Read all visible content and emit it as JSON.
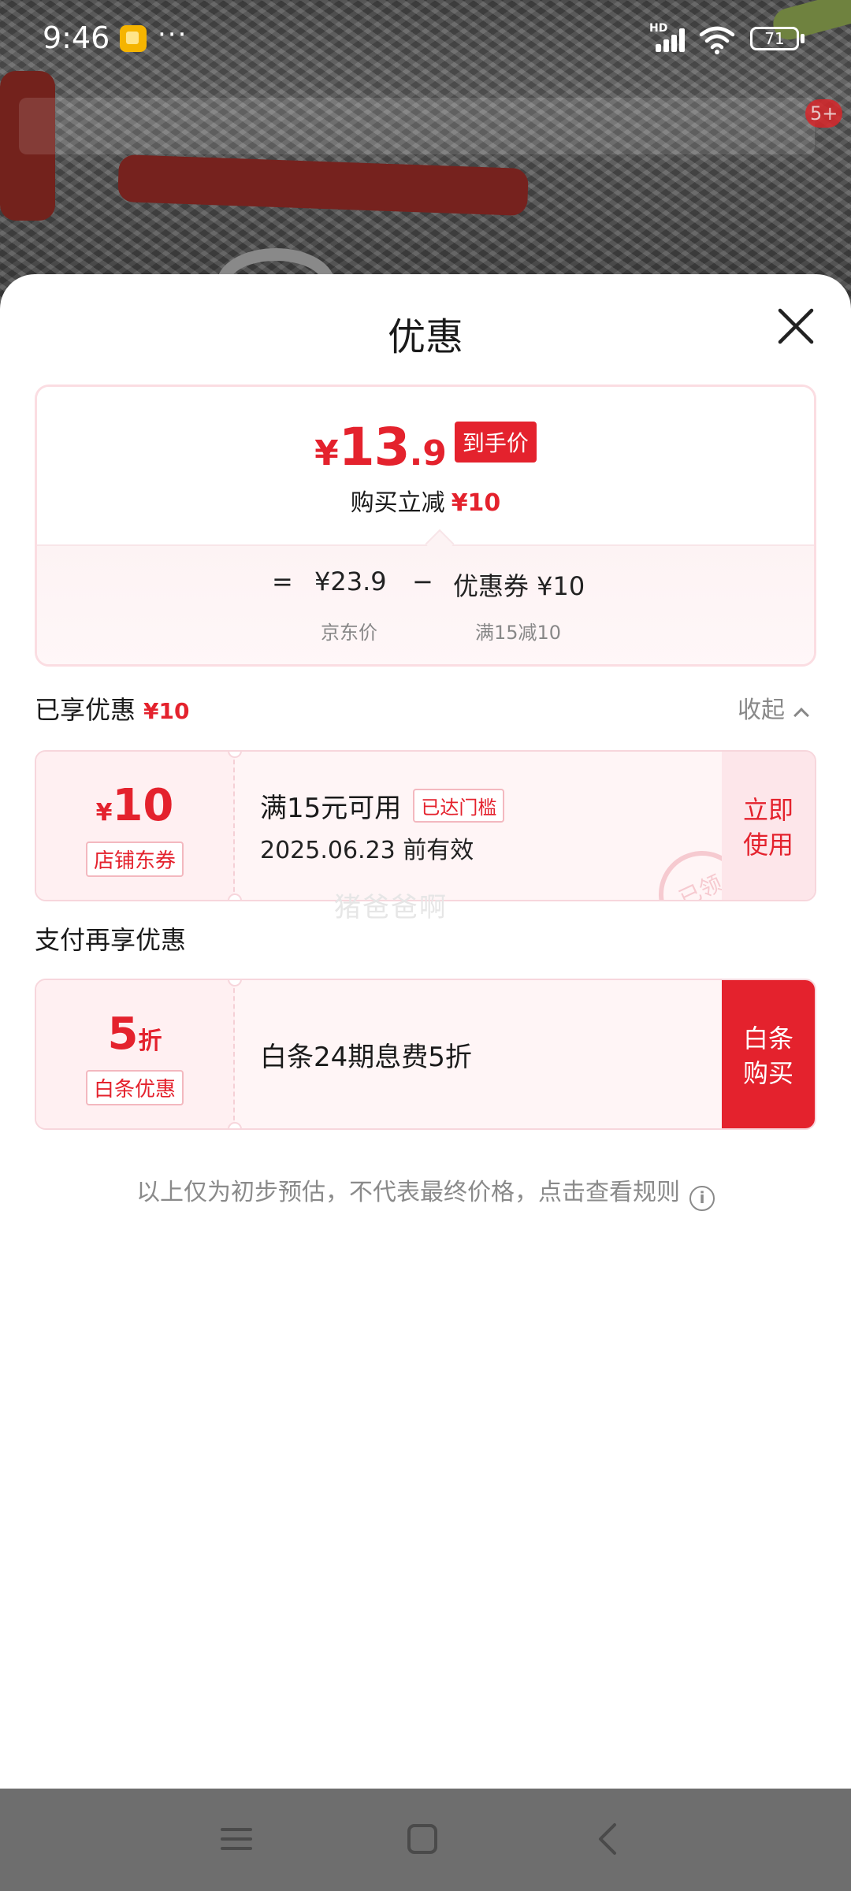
{
  "status_bar": {
    "time": "9:46",
    "dots": "···",
    "network": "HD",
    "battery": "71"
  },
  "overlay": {
    "cart_badge": "5+"
  },
  "sheet": {
    "title": "优惠"
  },
  "price_summary": {
    "currency": "¥",
    "final_price_int": "13",
    "final_price_dec": ".9",
    "final_price_tag": "到手价",
    "instant_cut_label": "购买立减",
    "instant_cut_amount": "¥10",
    "formula": {
      "equals": "=",
      "jd_price": "¥23.9",
      "minus": "−",
      "coupon_text": "优惠券 ¥10",
      "jd_price_caption": "京东价",
      "coupon_caption": "满15减10"
    }
  },
  "enjoyed": {
    "title": "已享优惠",
    "amount": "¥10",
    "collapse_label": "收起"
  },
  "shop_coupon": {
    "currency": "¥",
    "amount": "10",
    "type": "店铺东券",
    "condition": "满15元可用",
    "threshold_tag": "已达门槛",
    "validity": "2025.06.23 前有效",
    "action": "立即使用",
    "stamp": "已领"
  },
  "watermark": "猪爸爸啊",
  "pay_section": {
    "title": "支付再享优惠"
  },
  "baitiao": {
    "discount_number": "5",
    "discount_unit": "折",
    "type": "白条优惠",
    "description": "白条24期息费5折",
    "action": "白条购买"
  },
  "disclaimer": "以上仅为初步预估，不代表最终价格，点击查看规则",
  "colors": {
    "accent": "#e4222d",
    "card_border": "#fbdde2",
    "coupon_bg": "#fff5f6"
  }
}
